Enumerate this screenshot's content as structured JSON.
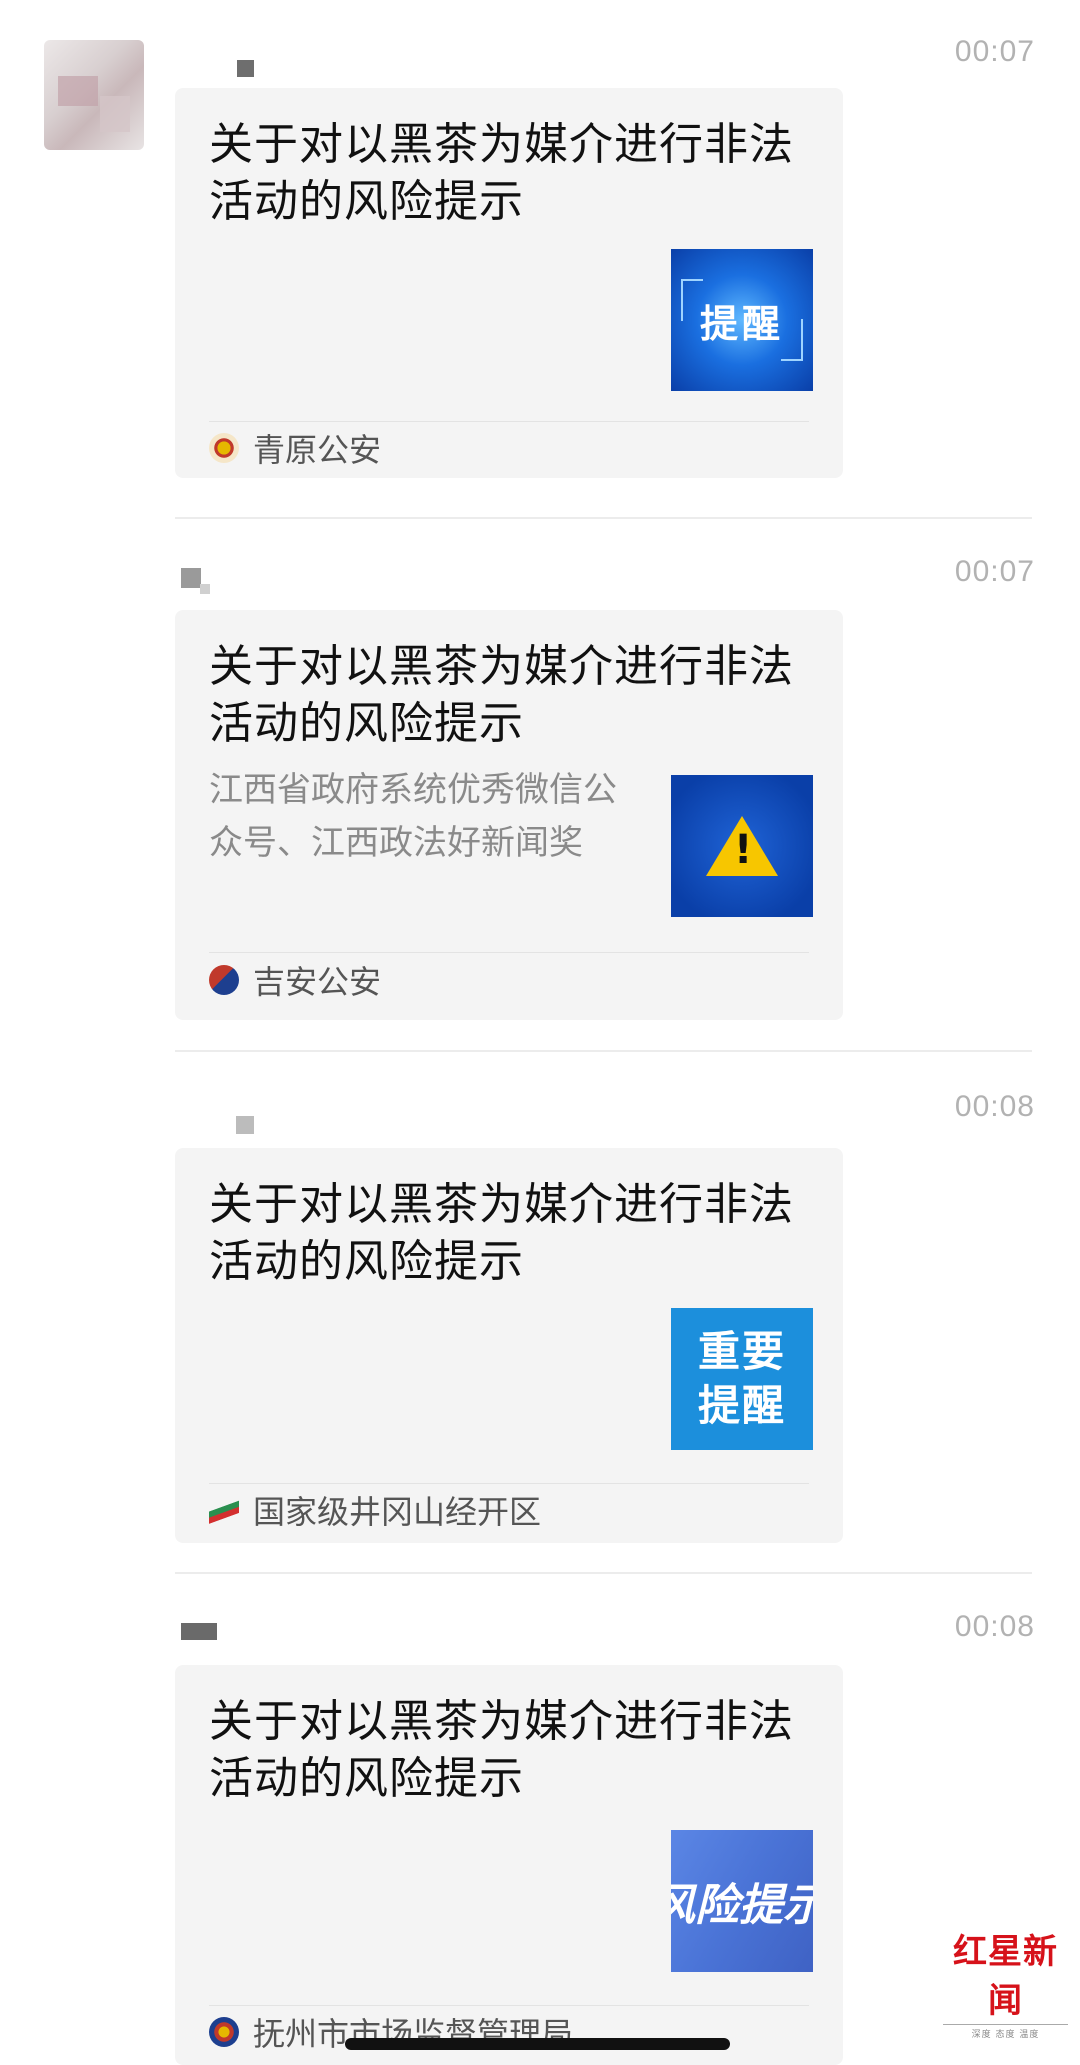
{
  "messages": [
    {
      "time": "00:07",
      "title": "关于对以黑茶为媒介进行非法活动的风险提示",
      "description": "",
      "thumbnail": {
        "text": "提醒",
        "style": "blue-frame"
      },
      "source": "青原公安"
    },
    {
      "time": "00:07",
      "title": "关于对以黑茶为媒介进行非法活动的风险提示",
      "description": "江西省政府系统优秀微信公众号、江西政法好新闻奖",
      "thumbnail": {
        "text": "!",
        "style": "warning"
      },
      "source": "吉安公安"
    },
    {
      "time": "00:08",
      "title": "关于对以黑茶为媒介进行非法活动的风险提示",
      "description": "",
      "thumbnail": {
        "text": "重要提醒",
        "style": "light-blue"
      },
      "source": "国家级井冈山经开区"
    },
    {
      "time": "00:08",
      "title": "关于对以黑茶为媒介进行非法活动的风险提示",
      "description": "",
      "thumbnail": {
        "text": "风险提示",
        "style": "diagonal"
      },
      "source": "抚州市市场监督管理局"
    }
  ],
  "watermark": {
    "main": "红星新闻",
    "sub": "深度 态度 温度"
  },
  "colors": {
    "card_bg": "#f4f4f4",
    "time": "#b2b2b2",
    "thumb_blue": "#0a4fb5",
    "warning_yellow": "#f7c600",
    "watermark_red": "#d6121a"
  }
}
